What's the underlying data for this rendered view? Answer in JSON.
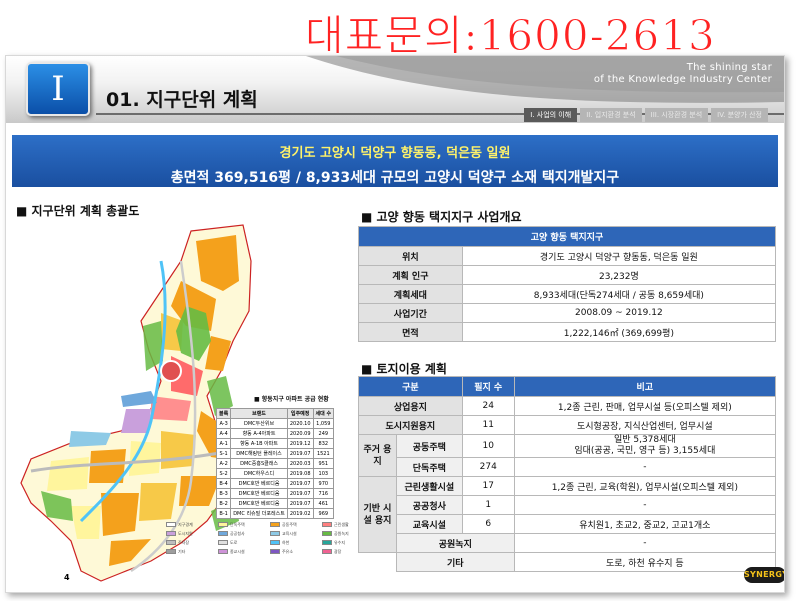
{
  "hotline": "대표문의:1600-2613",
  "header": {
    "roman": "I",
    "section_title": "01. 지구단위 계획",
    "tagline_line1": "The shining star",
    "tagline_line2": "of the Knowledge Industry Center",
    "tabs": [
      {
        "label": "I. 사업의 이해",
        "active": true
      },
      {
        "label": "II. 입지환경 분석",
        "active": false
      },
      {
        "label": "III. 시장환경 분석",
        "active": false
      },
      {
        "label": "IV. 분양가 산정",
        "active": false
      }
    ]
  },
  "banner": {
    "line1": "경기도 고양시 덕양구 향동동, 덕은동 일원",
    "line2": "총면적 369,516평 / 8,933세대 규모의 고양시 덕양구 소재 택지개발지구"
  },
  "left": {
    "heading": "■ 지구단위 계획 총괄도",
    "supply_title": "■ 향동지구 아파트 공급 현황",
    "supply_headers": [
      "블록",
      "브랜드",
      "입주예정",
      "세대 수"
    ],
    "supply_rows": [
      [
        "A-3",
        "DMC두산위브",
        "2020.10",
        "1,059"
      ],
      [
        "A-4",
        "향동 A-4아파트",
        "2020.09",
        "249"
      ],
      [
        "A-1",
        "향동 A-1B 아파트",
        "2019.12",
        "832"
      ],
      [
        "S-1",
        "DMC해링턴 플레이스",
        "2019.07",
        "1521"
      ],
      [
        "A-2",
        "DMC중흥S클래스",
        "2020.03",
        "951"
      ],
      [
        "S-2",
        "DMC하우스디",
        "2019.08",
        "103"
      ],
      [
        "B-4",
        "DMC호반 베르디움",
        "2019.07",
        "970"
      ],
      [
        "B-3",
        "DMC호반 베르디움",
        "2019.07",
        "716"
      ],
      [
        "B-2",
        "DMC호반 베르디움",
        "2019.07",
        "461"
      ],
      [
        "B-1",
        "DMC 리슈빌 더포레스트",
        "2019.02",
        "969"
      ]
    ],
    "legend": [
      {
        "label": "지구경계",
        "color": "#ffffff"
      },
      {
        "label": "단독주택",
        "color": "#fff59d"
      },
      {
        "label": "공동주택",
        "color": "#f4a11c"
      },
      {
        "label": "근린생활",
        "color": "#ff8080"
      },
      {
        "label": "도시지원",
        "color": "#c9a0dc"
      },
      {
        "label": "공공청사",
        "color": "#6fa8dc"
      },
      {
        "label": "교육시설",
        "color": "#8ecae6"
      },
      {
        "label": "공원녹지",
        "color": "#66bb44"
      },
      {
        "label": "주차장",
        "color": "#bdbdbd"
      },
      {
        "label": "도로",
        "color": "#e0e0e0"
      },
      {
        "label": "하천",
        "color": "#4fc3f7"
      },
      {
        "label": "유수지",
        "color": "#26a69a"
      },
      {
        "label": "기타",
        "color": "#9e9e9e"
      },
      {
        "label": "종교시설",
        "color": "#ce93d8"
      },
      {
        "label": "주유소",
        "color": "#7e57c2"
      },
      {
        "label": "광장",
        "color": "#f06292"
      }
    ]
  },
  "overview": {
    "heading": "■ 고양 향동 택지지구 사업개요",
    "table_title": "고양 향동 택지지구",
    "rows": [
      {
        "label": "위치",
        "value": "경기도 고양시 덕양구 향동동, 덕은동 일원"
      },
      {
        "label": "계획 인구",
        "value": "23,232명"
      },
      {
        "label": "계획세대",
        "value": "8,933세대(단독274세대 / 공동 8,659세대)"
      },
      {
        "label": "사업기간",
        "value": "2008.09 ~ 2019.12"
      },
      {
        "label": "면적",
        "value": "1,222,146㎡ (369,699평)"
      }
    ]
  },
  "landuse": {
    "heading": "■ 토지이용 계획",
    "headers": [
      "구분",
      "필지 수",
      "비고"
    ],
    "group_housing": "주거 용지",
    "group_infra": "기반 시설 용지",
    "rows": {
      "commercial": {
        "label": "상업용지",
        "count": "24",
        "note": "1,2종 근린, 판매, 업무시설 등(오피스텔 제외)"
      },
      "urban": {
        "label": "도시지원용지",
        "count": "11",
        "note": "도시형공장, 지식산업센터, 업무시설"
      },
      "apartment": {
        "label": "공동주택",
        "count": "10",
        "note_line1": "일반 5,378세대",
        "note_line2": "임대(공공, 국민, 영구 등) 3,155세대"
      },
      "detached": {
        "label": "단독주택",
        "count": "274",
        "note": "-"
      },
      "neighborhood": {
        "label": "근린생활시설",
        "count": "17",
        "note": "1,2종 근린, 교육(학원), 업무시설(오피스텔 제외)"
      },
      "public_office": {
        "label": "공공청사",
        "count": "1",
        "note": "-"
      },
      "education": {
        "label": "교육시설",
        "count": "6",
        "note": "유치원1, 초교2, 중교2, 고교1개소"
      },
      "park": {
        "label": "공원녹지",
        "count": "",
        "note": "-"
      },
      "etc": {
        "label": "기타",
        "count": "",
        "note": "도로, 하천 유수지 등"
      }
    }
  },
  "page_number": "4",
  "logo": "SYNERGY"
}
